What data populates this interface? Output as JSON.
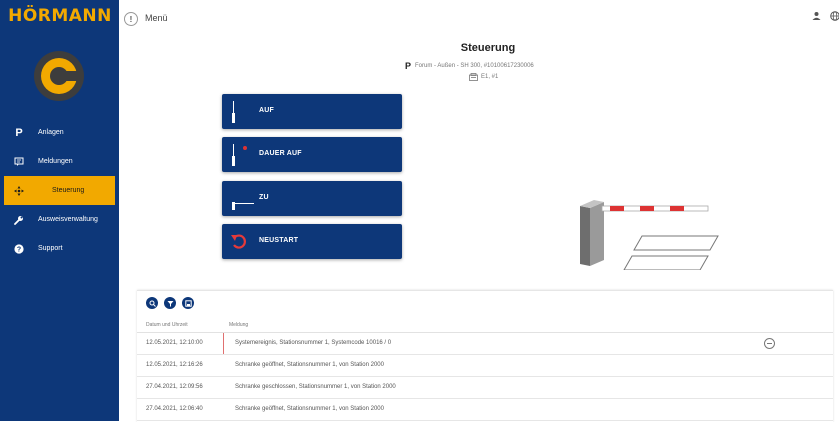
{
  "brand": {
    "logo_text": "HÖRMANN"
  },
  "sidebar": {
    "items": [
      {
        "icon": "p-icon",
        "glyph": "P",
        "label": "Anlagen"
      },
      {
        "icon": "message-icon",
        "glyph": "",
        "label": "Meldungen"
      },
      {
        "icon": "control-icon",
        "glyph": "",
        "label": "Steuerung",
        "active": true
      },
      {
        "icon": "wrench-icon",
        "glyph": "",
        "label": "Ausweisverwaltung"
      },
      {
        "icon": "question-icon",
        "glyph": "?",
        "label": "Support"
      }
    ]
  },
  "topbar": {
    "menu_label": "Menü",
    "menu_glyph": "!"
  },
  "header": {
    "title": "Steuerung",
    "p_glyph": "P",
    "subtitle": "Forum - Außen - SH 300, #10100617230006",
    "location": "E1, #1"
  },
  "commands": [
    {
      "label": "AUF",
      "icon": "barrier-up-icon"
    },
    {
      "label": "DAUER AUF",
      "icon": "barrier-permanent-up-icon"
    },
    {
      "label": "ZU",
      "icon": "barrier-down-icon"
    },
    {
      "label": "NEUSTART",
      "icon": "restart-icon"
    }
  ],
  "table": {
    "tools": [
      "search-icon",
      "filter-icon",
      "save-icon"
    ],
    "columns": [
      "Datum und Uhrzeit",
      "Meldung"
    ],
    "rows": [
      {
        "datetime": "12.05.2021, 12:10:00",
        "message": "Systemereignis, Stationsnummer 1, Systemcode 10016 / 0",
        "highlight": true
      },
      {
        "datetime": "12.05.2021, 12:16:26",
        "message": "Schranke geöffnet, Stationsnummer 1, von Station 2000"
      },
      {
        "datetime": "27.04.2021, 12:09:56",
        "message": "Schranke geschlossen, Stationsnummer 1, von Station 2000"
      },
      {
        "datetime": "27.04.2021, 12:06:40",
        "message": "Schranke geöffnet, Stationsnummer 1, von Station 2000"
      }
    ]
  },
  "colors": {
    "navy": "#0d3779",
    "accent": "#f2a900"
  }
}
